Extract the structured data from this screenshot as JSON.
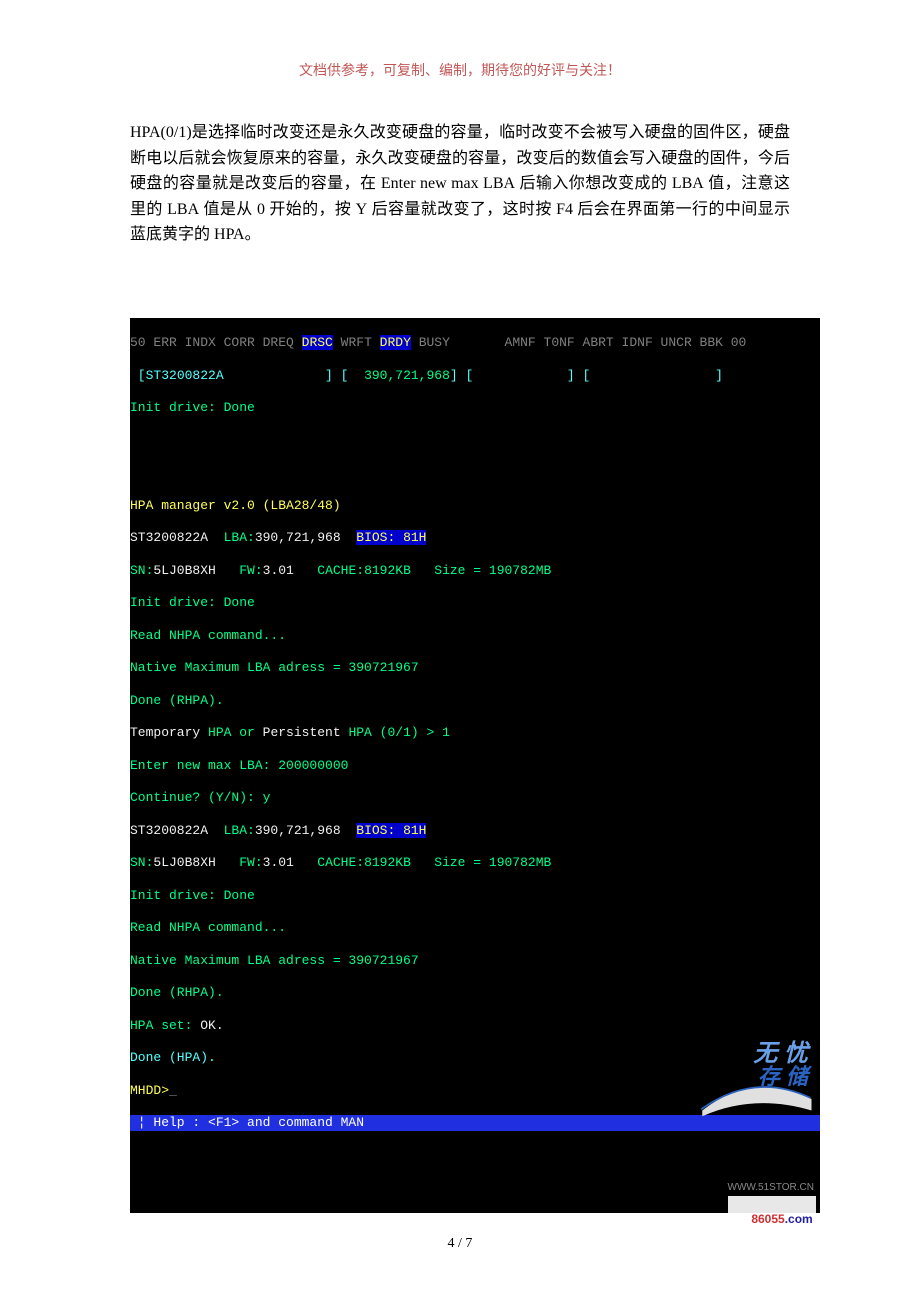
{
  "header_note": "文档供参考，可复制、编制，期待您的好评与关注！",
  "paragraph": {
    "p1a": "HPA(0/1)",
    "p1b": "是选择临时改变还是永久改变硬盘的容量，临时改变不会被写入硬盘的固件区，硬盘断电以后就会恢复原来的容量，永久改变硬盘的容量，改变后的数值会写入硬盘的固件，今后硬盘的容量就是改变后的容量，在 ",
    "p1c": "Enter new max LBA",
    "p1d": " 后输入你想改变成的 ",
    "p1e": "LBA",
    "p1f": " 值，注意这里的 ",
    "p1g": "LBA",
    "p1h": " 值是从 ",
    "p1i": "0",
    "p1j": " 开始的，按 ",
    "p1k": "Y",
    "p1l": " 后容量就改变了，这时按 ",
    "p1m": "F4",
    "p1n": " 后会在界面第一行的中间显示蓝底黄字的 ",
    "p1o": "HPA",
    "p1p": "。"
  },
  "term": {
    "status_dim1": "50 ERR INDX CORR DREQ ",
    "status_hl1": "DRSC",
    "status_dim2": " WRFT ",
    "status_hl2": "DRDY",
    "status_dim3": " BUSY",
    "status_dim4": "AMNF T0NF ABRT IDNF UNCR BBK 00",
    "bracket_model": "ST3200822A",
    "bracket_lba": "390,721,968",
    "init": "Init drive: Done",
    "hpa_title": "HPA manager v2.0 (LBA28/48)",
    "dev_a": "ST3200822A",
    "dev_lba_lbl": "  LBA:",
    "dev_lba": "390,721,968",
    "dev_bios_lbl": "  ",
    "dev_bios": "BIOS: 81H",
    "sn_lbl": "SN:",
    "sn": "5LJ0B8XH",
    "fw_lbl": "   FW:",
    "fw": "3.01",
    "cache": "   CACHE:8192KB   Size = 190782MB",
    "read_cmd": "Read NHPA command...",
    "native": "Native Maximum LBA adress = 390721967",
    "done_rhpa": "Done (RHPA).",
    "temp": "Temporary",
    "persist": "Persistent",
    "hpa_q": " HPA or ",
    "hpa_q2": " HPA (0/1) > 1",
    "enter_lba": "Enter new max LBA: 200000000",
    "cont": "Continue? (Y/N): y",
    "hpa_set_lbl": "HPA set: ",
    "ok": "OK.",
    "done_hpa": "Done (HPA).",
    "prompt": "MHDD>",
    "cursor": "_",
    "help": " ¦ Help : <F1> and command MAN",
    "wm1": "无 忧",
    "wm2": "存 储",
    "wm_url": "WWW.51STOR.CN",
    "logo_red": "86055",
    "logo_blue": ".com"
  },
  "pagenum": "4 / 7"
}
